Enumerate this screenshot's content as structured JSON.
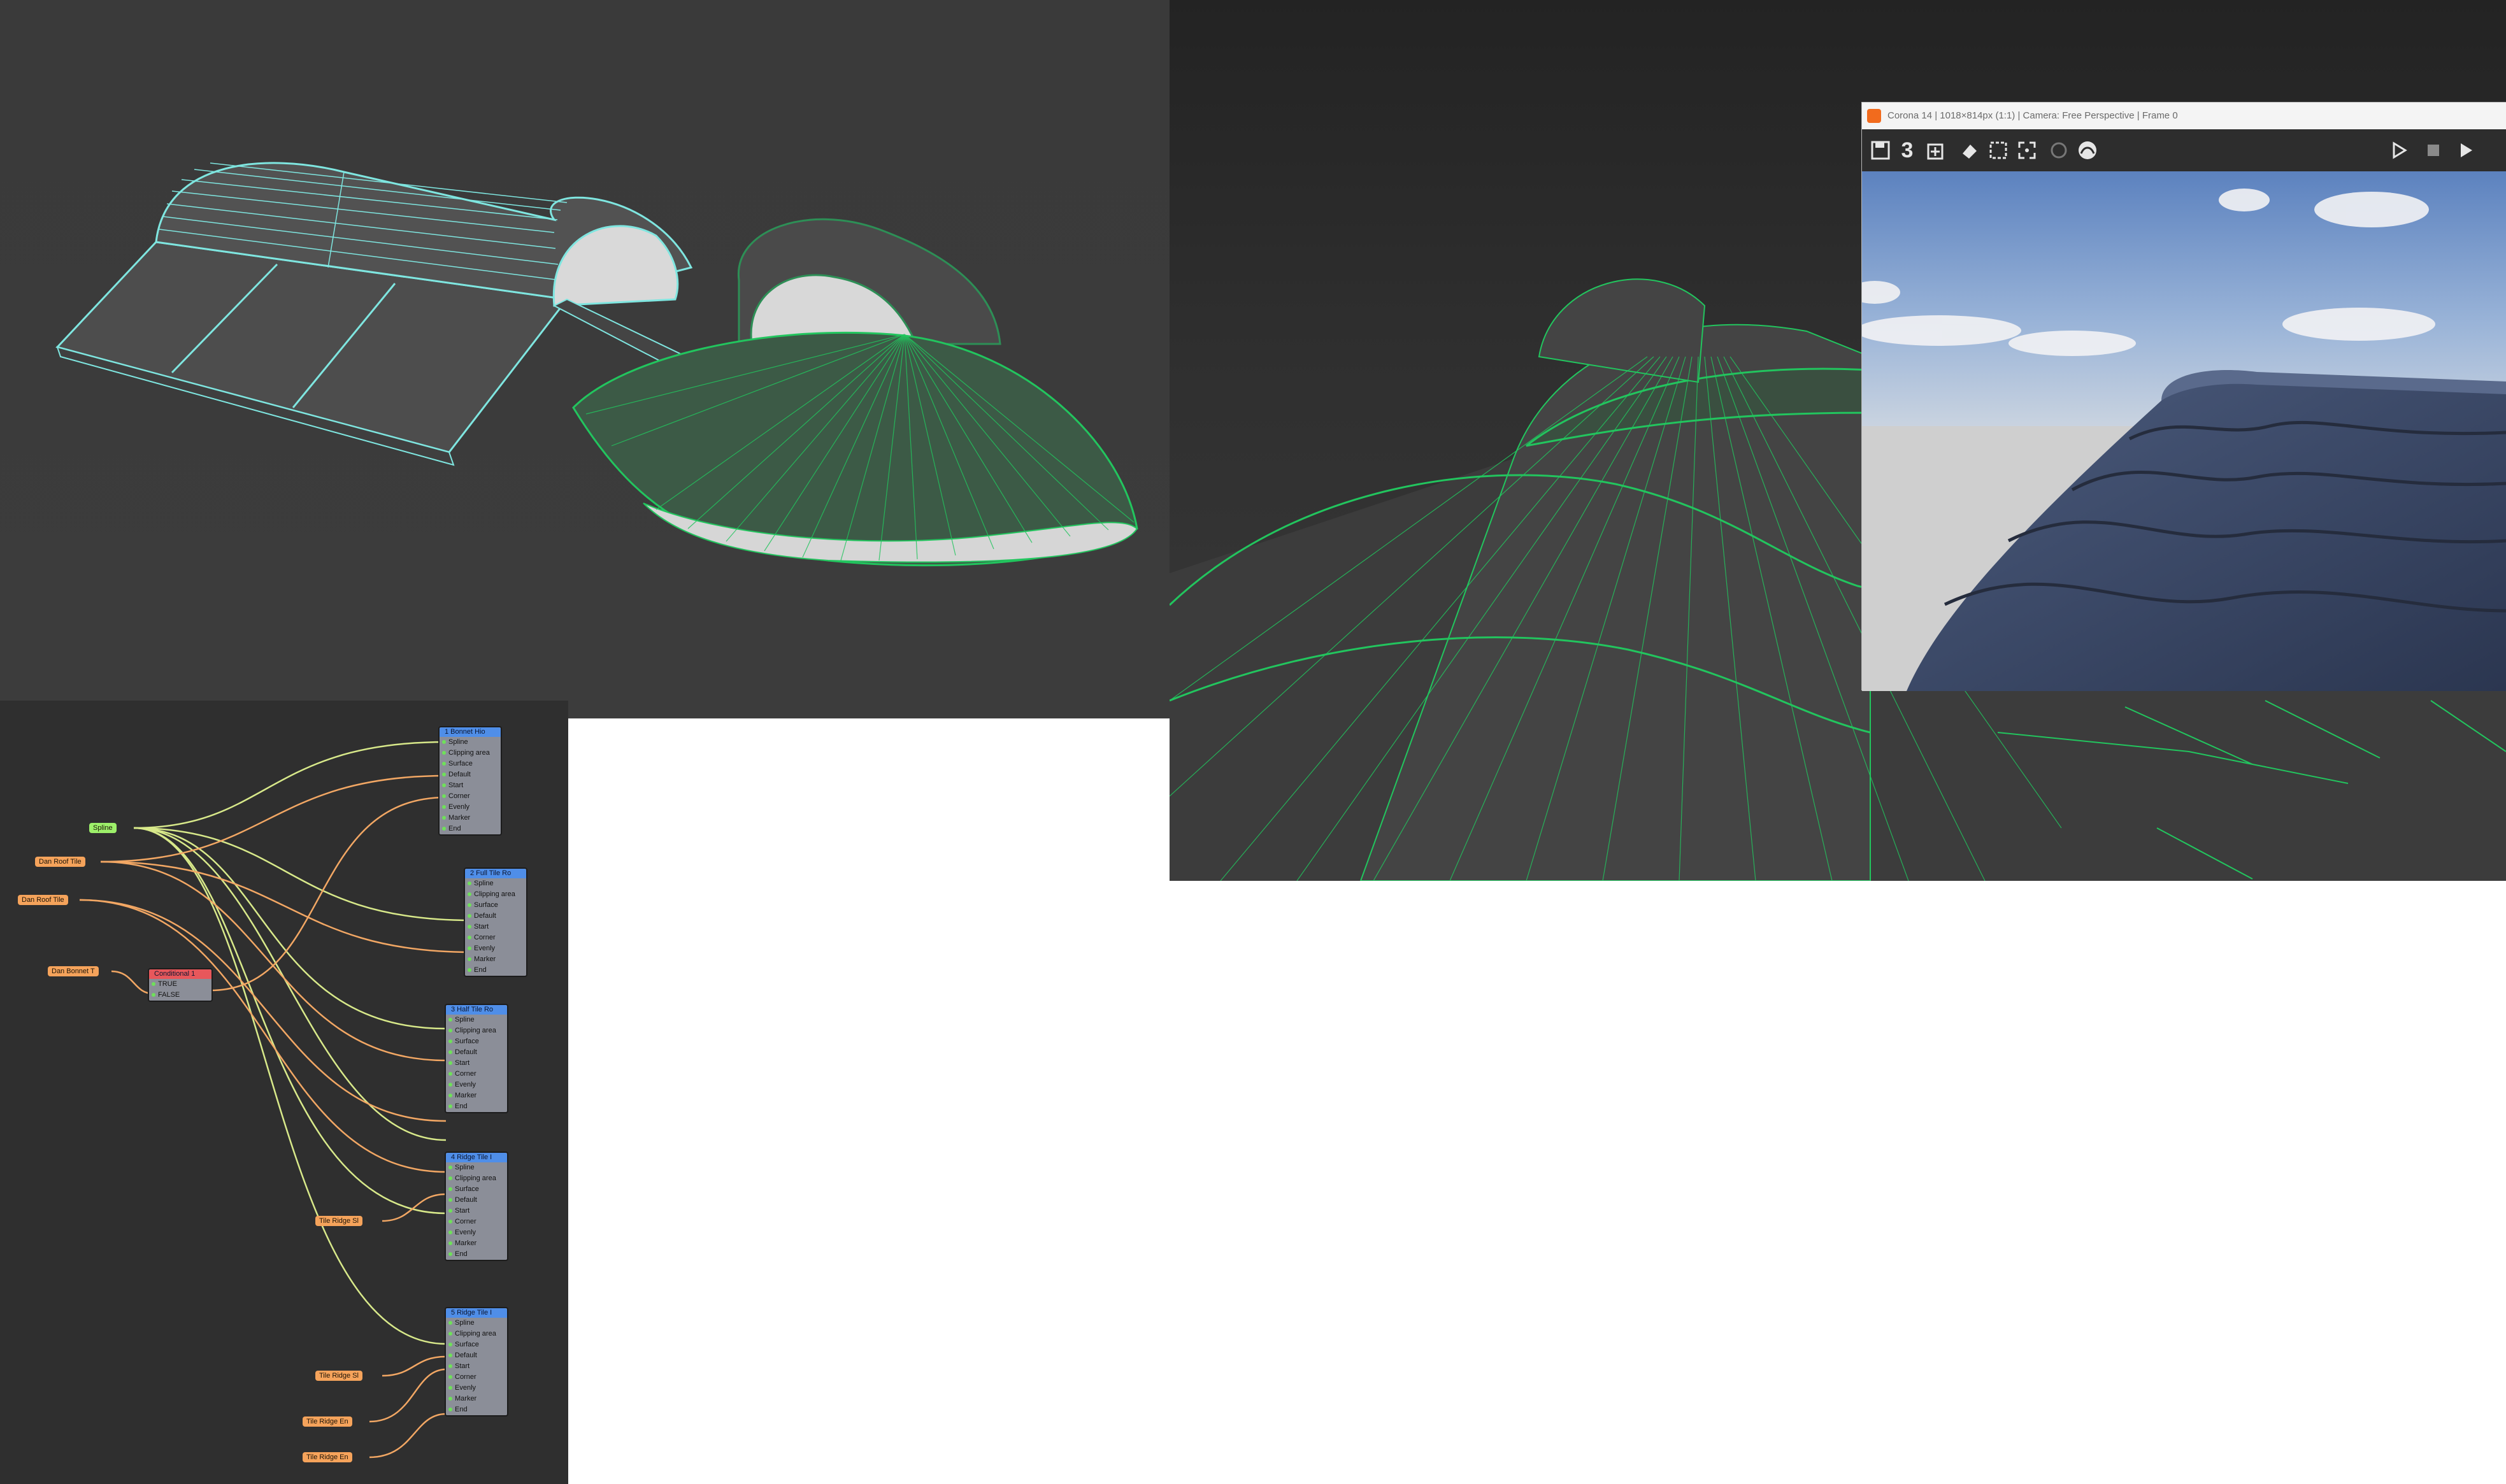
{
  "render_window": {
    "title": "Corona 14 | 1018×814px (1:1) | Camera: Free Perspective | Frame 0",
    "toolbar": {
      "save_icon": "save-icon",
      "number_label": "3",
      "play_icon": "play-icon",
      "stop_icon": "stop-icon",
      "render_icon": "render-icon"
    }
  },
  "graph": {
    "sources": [
      {
        "label": "Spline"
      },
      {
        "label": "Dan Roof Tile"
      },
      {
        "label": "Dan Roof Tile"
      },
      {
        "label": "Dan Bonnet T"
      },
      {
        "label": "Tile Ridge Sl"
      },
      {
        "label": "Tile Ridge Sl"
      },
      {
        "label": "Tile Ridge En"
      },
      {
        "label": "Tile Ridge En"
      }
    ],
    "conditional": {
      "title": "Conditional 1",
      "rows": [
        "TRUE",
        "FALSE"
      ]
    },
    "nodes": [
      {
        "title": "1 Bonnet Hio",
        "rows": [
          "Spline",
          "Clipping area",
          "Surface",
          "Default",
          "Start",
          "Corner",
          "Evenly",
          "Marker",
          "End"
        ]
      },
      {
        "title": "2 Full Tile Ro",
        "rows": [
          "Spline",
          "Clipping area",
          "Surface",
          "Default",
          "Start",
          "Corner",
          "Evenly",
          "Marker",
          "End"
        ]
      },
      {
        "title": "3 Half Tile Ro",
        "rows": [
          "Spline",
          "Clipping area",
          "Surface",
          "Default",
          "Start",
          "Corner",
          "Evenly",
          "Marker",
          "End"
        ]
      },
      {
        "title": "4 Ridge Tile I",
        "rows": [
          "Spline",
          "Clipping area",
          "Surface",
          "Default",
          "Start",
          "Corner",
          "Evenly",
          "Marker",
          "End"
        ]
      },
      {
        "title": "5 Ridge Tile I",
        "rows": [
          "Spline",
          "Clipping area",
          "Surface",
          "Default",
          "Start",
          "Corner",
          "Evenly",
          "Marker",
          "End"
        ]
      }
    ]
  },
  "colors": {
    "wire_cyan": "#7fe6e0",
    "wire_green": "#22c55e",
    "node_header": "#4f8ee8",
    "source_orange": "#f5a35b",
    "source_green": "#9df06a",
    "link_yellow": "#d8e98a",
    "link_orange": "#f2a764"
  }
}
